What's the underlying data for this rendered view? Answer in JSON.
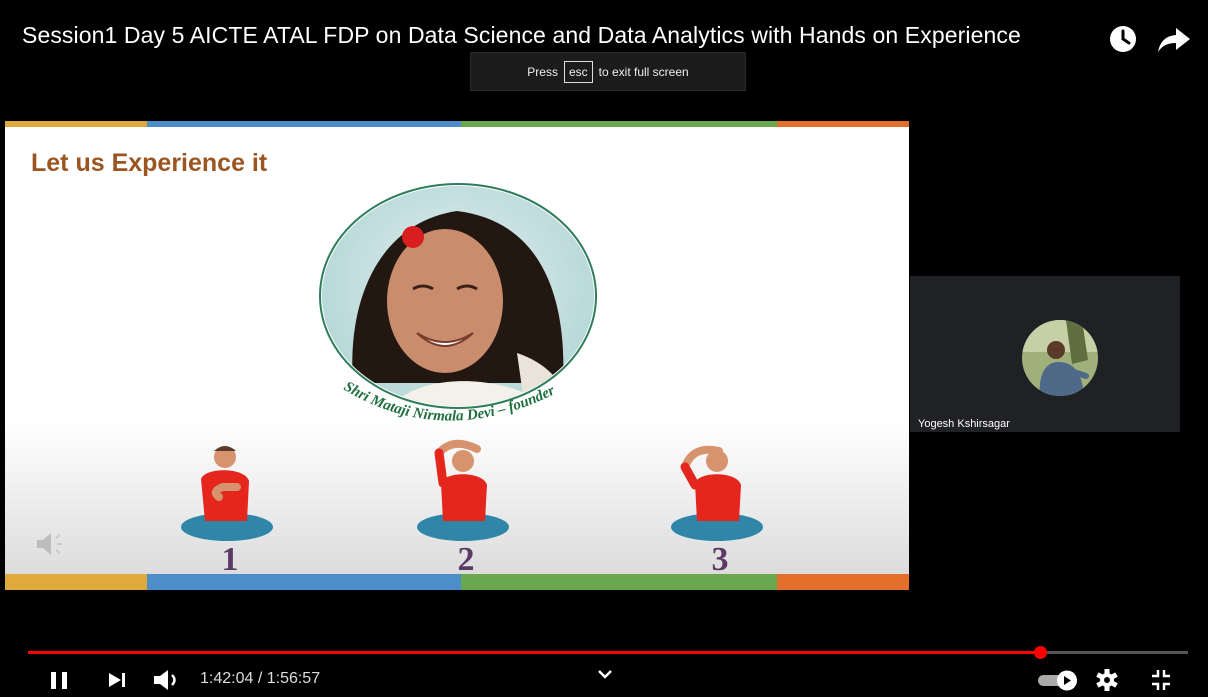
{
  "header": {
    "title": "Session1 Day 5 AICTE ATAL FDP on Data Science and Data Analytics with Hands on Experience",
    "icons": [
      "clock-icon",
      "share-icon"
    ]
  },
  "toast": {
    "prefix": "Press",
    "key": "esc",
    "suffix": "to exit full screen"
  },
  "slide": {
    "heading": "Let us Experience it",
    "caption": "Shri Mataji Nirmala Devi – founder",
    "steps": [
      "1",
      "2",
      "3"
    ],
    "strip_colors": [
      "#e0a93b",
      "#4c8ec9",
      "#6aa84f",
      "#e36f2b"
    ]
  },
  "participant": {
    "name": "Yogesh Kshirsagar"
  },
  "player": {
    "current_time": "1:42:04",
    "duration": "1:56:57",
    "time_text": "1:42:04 / 1:56:57",
    "progress": 0.8727,
    "accent": "#ff0000",
    "icons": [
      "pause-icon",
      "next-icon",
      "volume-icon",
      "chevron-down-icon",
      "autoplay-toggle-icon",
      "settings-gear-icon",
      "exit-fullscreen-icon"
    ]
  }
}
